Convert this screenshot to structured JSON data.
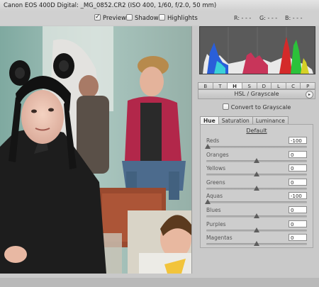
{
  "window": {
    "title": "Canon EOS 400D Digital:  _MG_0852.CR2  (ISO 400, 1/60, f/2.0, 50 mm)"
  },
  "options": {
    "preview": {
      "label": "Preview",
      "checked": true
    },
    "shadows": {
      "label": "Shadows",
      "checked": false
    },
    "highlights": {
      "label": "Highlights",
      "checked": false
    },
    "readout": {
      "r": "R:  - - -",
      "g": "G:  - - -",
      "b": "B:  - - -"
    }
  },
  "panel_tabs": [
    "B",
    "T",
    "H",
    "S",
    "D",
    "L",
    "C",
    "P"
  ],
  "active_panel_tab": "H",
  "section": {
    "title": "HSL / Grayscale",
    "convert_label": "Convert to Grayscale",
    "subtabs": [
      "Hue",
      "Saturation",
      "Luminance"
    ],
    "active_subtab": "Hue",
    "default_label": "Default"
  },
  "sliders": [
    {
      "label": "Reds",
      "value": "-100",
      "level": 0.0
    },
    {
      "label": "Oranges",
      "value": "0",
      "level": 0.5
    },
    {
      "label": "Yellows",
      "value": "0",
      "level": 0.5
    },
    {
      "label": "Greens",
      "value": "0",
      "level": 0.5
    },
    {
      "label": "Aquas",
      "value": "-100",
      "level": 0.0
    },
    {
      "label": "Blues",
      "value": "0",
      "level": 0.5
    },
    {
      "label": "Purples",
      "value": "0",
      "level": 0.5
    },
    {
      "label": "Magentas",
      "value": "0",
      "level": 0.5
    }
  ],
  "colors": {
    "histogram_bg": "#5a5a5a",
    "panel_bg": "#c9c9c9"
  }
}
